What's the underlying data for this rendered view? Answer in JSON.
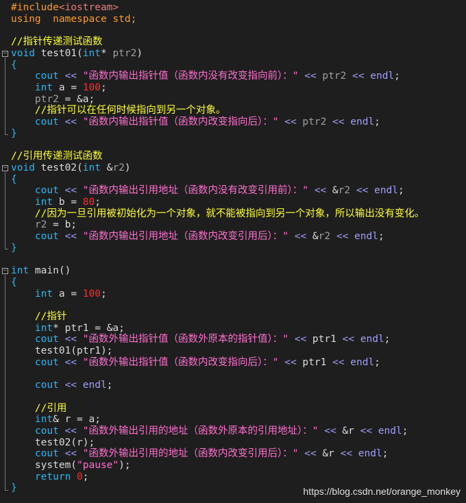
{
  "lines": [
    {
      "tokens": [
        {
          "t": "#include",
          "c": "pp"
        },
        {
          "t": "<iostream>",
          "c": "inc"
        }
      ]
    },
    {
      "tokens": [
        {
          "t": "using",
          "c": "kw"
        },
        {
          "t": "  ",
          "c": "plain"
        },
        {
          "t": "namespace",
          "c": "kw"
        },
        {
          "t": " ",
          "c": "plain"
        },
        {
          "t": "std",
          "c": "kw"
        },
        {
          "t": ";",
          "c": "kw"
        }
      ]
    },
    {
      "tokens": []
    },
    {
      "tokens": [
        {
          "t": "//指针传递测试函数",
          "c": "cmt"
        }
      ]
    },
    {
      "tokens": [
        {
          "t": "void",
          "c": "type"
        },
        {
          "t": " test01(",
          "c": "plain"
        },
        {
          "t": "int",
          "c": "type"
        },
        {
          "t": "* ",
          "c": "plain"
        },
        {
          "t": "ptr2",
          "c": "param"
        },
        {
          "t": ")",
          "c": "plain"
        }
      ]
    },
    {
      "tokens": [
        {
          "t": "{",
          "c": "brace"
        }
      ]
    },
    {
      "tokens": [
        {
          "t": "    ",
          "c": "plain"
        },
        {
          "t": "cout",
          "c": "cout"
        },
        {
          "t": " << ",
          "c": "op"
        },
        {
          "t": "\"函数内输出指针值（函数内没有改变指向前）：\"",
          "c": "str"
        },
        {
          "t": " << ",
          "c": "op"
        },
        {
          "t": "ptr2",
          "c": "param"
        },
        {
          "t": " << ",
          "c": "op"
        },
        {
          "t": "endl",
          "c": "op"
        },
        {
          "t": ";",
          "c": "plain"
        }
      ]
    },
    {
      "tokens": [
        {
          "t": "    ",
          "c": "plain"
        },
        {
          "t": "int",
          "c": "type"
        },
        {
          "t": " a = ",
          "c": "plain"
        },
        {
          "t": "100",
          "c": "num"
        },
        {
          "t": ";",
          "c": "plain"
        }
      ]
    },
    {
      "tokens": [
        {
          "t": "    ",
          "c": "plain"
        },
        {
          "t": "ptr2",
          "c": "param"
        },
        {
          "t": " = &a;",
          "c": "plain"
        }
      ]
    },
    {
      "tokens": [
        {
          "t": "    ",
          "c": "plain"
        },
        {
          "t": "//指针可以在任何时候指向到另一个对象。",
          "c": "cmt"
        }
      ]
    },
    {
      "tokens": [
        {
          "t": "    ",
          "c": "plain"
        },
        {
          "t": "cout",
          "c": "cout"
        },
        {
          "t": " << ",
          "c": "op"
        },
        {
          "t": "\"函数内输出指针值（函数内改变指向后）：\"",
          "c": "str"
        },
        {
          "t": " << ",
          "c": "op"
        },
        {
          "t": "ptr2",
          "c": "param"
        },
        {
          "t": " << ",
          "c": "op"
        },
        {
          "t": "endl",
          "c": "op"
        },
        {
          "t": ";",
          "c": "plain"
        }
      ]
    },
    {
      "tokens": [
        {
          "t": "}",
          "c": "brace"
        }
      ]
    },
    {
      "tokens": []
    },
    {
      "tokens": [
        {
          "t": "//引用传递测试函数",
          "c": "cmt"
        }
      ]
    },
    {
      "tokens": [
        {
          "t": "void",
          "c": "type"
        },
        {
          "t": " test02(",
          "c": "plain"
        },
        {
          "t": "int",
          "c": "type"
        },
        {
          "t": " &",
          "c": "plain"
        },
        {
          "t": "r2",
          "c": "param"
        },
        {
          "t": ")",
          "c": "plain"
        }
      ]
    },
    {
      "tokens": [
        {
          "t": "{",
          "c": "brace"
        }
      ]
    },
    {
      "tokens": [
        {
          "t": "    ",
          "c": "plain"
        },
        {
          "t": "cout",
          "c": "cout"
        },
        {
          "t": " << ",
          "c": "op"
        },
        {
          "t": "\"函数内输出引用地址（函数内没有改变引用前）：\"",
          "c": "str"
        },
        {
          "t": " << ",
          "c": "op"
        },
        {
          "t": "&",
          "c": "plain"
        },
        {
          "t": "r2",
          "c": "param"
        },
        {
          "t": " << ",
          "c": "op"
        },
        {
          "t": "endl",
          "c": "op"
        },
        {
          "t": ";",
          "c": "plain"
        }
      ]
    },
    {
      "tokens": [
        {
          "t": "    ",
          "c": "plain"
        },
        {
          "t": "int",
          "c": "type"
        },
        {
          "t": " b = ",
          "c": "plain"
        },
        {
          "t": "80",
          "c": "num"
        },
        {
          "t": ";",
          "c": "plain"
        }
      ]
    },
    {
      "tokens": [
        {
          "t": "    ",
          "c": "plain"
        },
        {
          "t": "//因为一旦引用被初始化为一个对象，就不能被指向到另一个对象，所以输出没有变化。",
          "c": "cmt"
        }
      ]
    },
    {
      "tokens": [
        {
          "t": "    ",
          "c": "plain"
        },
        {
          "t": "r2",
          "c": "param"
        },
        {
          "t": " = b;",
          "c": "plain"
        }
      ]
    },
    {
      "tokens": [
        {
          "t": "    ",
          "c": "plain"
        },
        {
          "t": "cout",
          "c": "cout"
        },
        {
          "t": " << ",
          "c": "op"
        },
        {
          "t": "\"函数内输出引用地址（函数内改变引用后）：\"",
          "c": "str"
        },
        {
          "t": " << ",
          "c": "op"
        },
        {
          "t": "&",
          "c": "plain"
        },
        {
          "t": "r2",
          "c": "param"
        },
        {
          "t": " << ",
          "c": "op"
        },
        {
          "t": "endl",
          "c": "op"
        },
        {
          "t": ";",
          "c": "plain"
        }
      ]
    },
    {
      "tokens": [
        {
          "t": "}",
          "c": "brace"
        }
      ]
    },
    {
      "tokens": []
    },
    {
      "tokens": [
        {
          "t": "int",
          "c": "type"
        },
        {
          "t": " main()",
          "c": "plain"
        }
      ]
    },
    {
      "tokens": [
        {
          "t": "{",
          "c": "brace"
        }
      ]
    },
    {
      "tokens": [
        {
          "t": "    ",
          "c": "plain"
        },
        {
          "t": "int",
          "c": "type"
        },
        {
          "t": " a = ",
          "c": "plain"
        },
        {
          "t": "100",
          "c": "num"
        },
        {
          "t": ";",
          "c": "plain"
        }
      ]
    },
    {
      "tokens": []
    },
    {
      "tokens": [
        {
          "t": "    ",
          "c": "plain"
        },
        {
          "t": "//指针",
          "c": "cmt"
        }
      ]
    },
    {
      "tokens": [
        {
          "t": "    ",
          "c": "plain"
        },
        {
          "t": "int",
          "c": "type"
        },
        {
          "t": "* ptr1 = &a;",
          "c": "plain"
        }
      ]
    },
    {
      "tokens": [
        {
          "t": "    ",
          "c": "plain"
        },
        {
          "t": "cout",
          "c": "cout"
        },
        {
          "t": " << ",
          "c": "op"
        },
        {
          "t": "\"函数外输出指针值（函数外原本的指针值）：\"",
          "c": "str"
        },
        {
          "t": " << ",
          "c": "op"
        },
        {
          "t": "ptr1",
          "c": "plain"
        },
        {
          "t": " << ",
          "c": "op"
        },
        {
          "t": "endl",
          "c": "op"
        },
        {
          "t": ";",
          "c": "plain"
        }
      ]
    },
    {
      "tokens": [
        {
          "t": "    ",
          "c": "plain"
        },
        {
          "t": "test01(ptr1);",
          "c": "plain"
        }
      ]
    },
    {
      "tokens": [
        {
          "t": "    ",
          "c": "plain"
        },
        {
          "t": "cout",
          "c": "cout"
        },
        {
          "t": " << ",
          "c": "op"
        },
        {
          "t": "\"函数外输出指针值（函数内改变指向后）：\"",
          "c": "str"
        },
        {
          "t": " << ",
          "c": "op"
        },
        {
          "t": "ptr1",
          "c": "plain"
        },
        {
          "t": " << ",
          "c": "op"
        },
        {
          "t": "endl",
          "c": "op"
        },
        {
          "t": ";",
          "c": "plain"
        }
      ]
    },
    {
      "tokens": []
    },
    {
      "tokens": [
        {
          "t": "    ",
          "c": "plain"
        },
        {
          "t": "cout",
          "c": "cout"
        },
        {
          "t": " << ",
          "c": "op"
        },
        {
          "t": "endl",
          "c": "op"
        },
        {
          "t": ";",
          "c": "plain"
        }
      ]
    },
    {
      "tokens": []
    },
    {
      "tokens": [
        {
          "t": "    ",
          "c": "plain"
        },
        {
          "t": "//引用",
          "c": "cmt"
        }
      ]
    },
    {
      "tokens": [
        {
          "t": "    ",
          "c": "plain"
        },
        {
          "t": "int",
          "c": "type"
        },
        {
          "t": "& r = a;",
          "c": "plain"
        }
      ]
    },
    {
      "tokens": [
        {
          "t": "    ",
          "c": "plain"
        },
        {
          "t": "cout",
          "c": "cout"
        },
        {
          "t": " << ",
          "c": "op"
        },
        {
          "t": "\"函数外输出引用的地址（函数外原本的引用地址）：\"",
          "c": "str"
        },
        {
          "t": " << ",
          "c": "op"
        },
        {
          "t": "&r",
          "c": "plain"
        },
        {
          "t": " << ",
          "c": "op"
        },
        {
          "t": "endl",
          "c": "op"
        },
        {
          "t": ";",
          "c": "plain"
        }
      ]
    },
    {
      "tokens": [
        {
          "t": "    ",
          "c": "plain"
        },
        {
          "t": "test02(r);",
          "c": "plain"
        }
      ]
    },
    {
      "tokens": [
        {
          "t": "    ",
          "c": "plain"
        },
        {
          "t": "cout",
          "c": "cout"
        },
        {
          "t": " << ",
          "c": "op"
        },
        {
          "t": "\"函数外输出引用的地址（函数内改变引用后）：\"",
          "c": "str"
        },
        {
          "t": " << ",
          "c": "op"
        },
        {
          "t": "&r",
          "c": "plain"
        },
        {
          "t": " << ",
          "c": "op"
        },
        {
          "t": "endl",
          "c": "op"
        },
        {
          "t": ";",
          "c": "plain"
        }
      ]
    },
    {
      "tokens": [
        {
          "t": "    ",
          "c": "plain"
        },
        {
          "t": "system(",
          "c": "plain"
        },
        {
          "t": "\"pause\"",
          "c": "str"
        },
        {
          "t": ");",
          "c": "plain"
        }
      ]
    },
    {
      "tokens": [
        {
          "t": "    ",
          "c": "plain"
        },
        {
          "t": "return",
          "c": "type"
        },
        {
          "t": " ",
          "c": "plain"
        },
        {
          "t": "0",
          "c": "num"
        },
        {
          "t": ";",
          "c": "plain"
        }
      ]
    },
    {
      "tokens": [
        {
          "t": "}",
          "c": "brace"
        }
      ]
    }
  ],
  "watermark": "https://blog.csdn.net/orange_monkey",
  "colors": {
    "background": "#1e1e1e",
    "keyword": "#ff9c2a",
    "type": "#2ab7f5",
    "number": "#ff2d2d",
    "string": "#ff6fd0",
    "comment": "#ffff33",
    "operator": "#9f9fff"
  },
  "icons": {
    "fold_collapse": "minus-box-icon"
  }
}
